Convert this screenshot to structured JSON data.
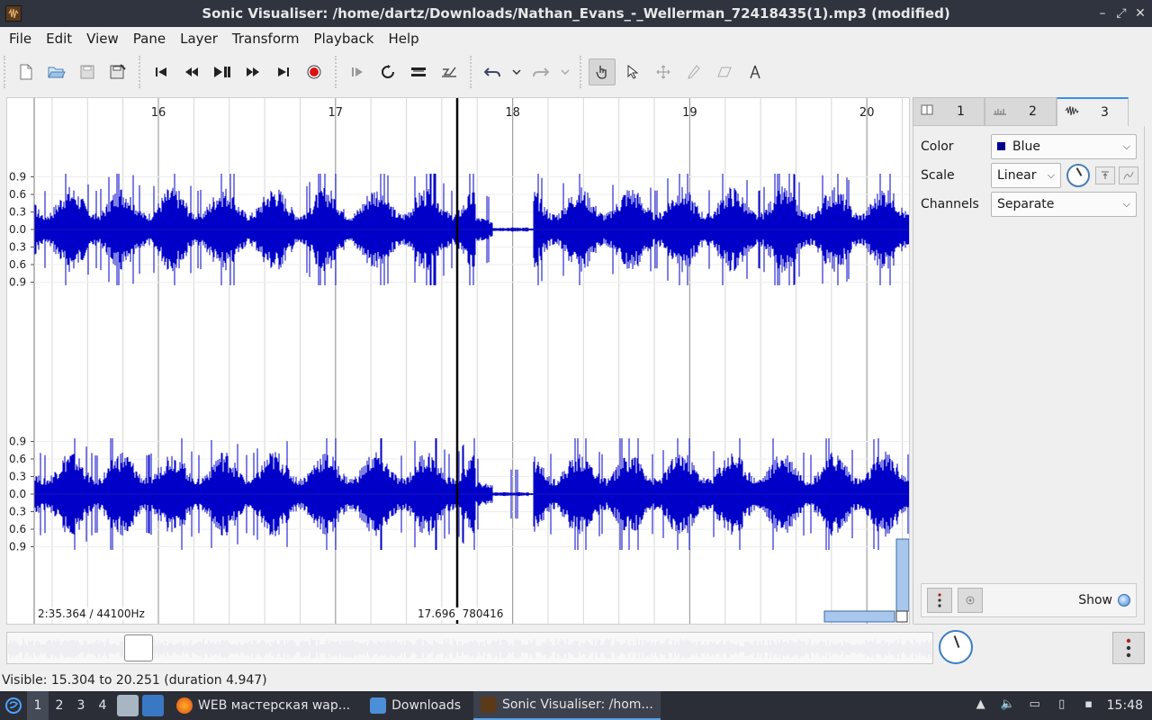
{
  "window": {
    "title": "Sonic Visualiser: /home/dartz/Downloads/Nathan_Evans_-_Wellerman_72418435(1).mp3 (modified)",
    "controls": [
      "–",
      "⤢",
      "✕"
    ]
  },
  "menu": [
    "File",
    "Edit",
    "View",
    "Pane",
    "Layer",
    "Transform",
    "Playback",
    "Help"
  ],
  "toolbar": {
    "file_icons": [
      "new-file-icon",
      "open-file-icon",
      "save-icon",
      "save-as-icon"
    ],
    "transport_icons": [
      "skip-to-start-icon",
      "rewind-icon",
      "play-pause-icon",
      "fast-forward-icon",
      "skip-to-end-icon",
      "record-icon"
    ],
    "playmode_icons": [
      "play-selection-icon",
      "loop-icon",
      "solo-icon",
      "speed-icon"
    ],
    "edit_icons": [
      "undo-icon",
      "undo-menu-icon",
      "redo-icon",
      "redo-menu-icon"
    ],
    "tool_icons": [
      "navigate-tool-icon",
      "select-tool-icon",
      "move-tool-icon",
      "draw-tool-icon",
      "erase-tool-icon",
      "measure-tool-icon"
    ]
  },
  "timeline": {
    "ticks": [
      "16",
      "17",
      "18",
      "19",
      "20"
    ],
    "amp_labels_top": [
      "0.9",
      "0.6",
      "0.3",
      "0.0",
      "0.3",
      "0.6",
      "0.9"
    ],
    "amp_labels_bottom": [
      "0.9",
      "0.6",
      "0.3",
      "0.0",
      "0.3",
      "0.6",
      "0.9"
    ],
    "bottom_left_info": "2:35.364 / 44100Hz",
    "playhead_info": "17.696  780416",
    "waveform_color": "#0000c8"
  },
  "panel": {
    "tabs": [
      {
        "label": "1",
        "icon": "pane-icon"
      },
      {
        "label": "2",
        "icon": "time-ruler-icon"
      },
      {
        "label": "3",
        "icon": "waveform-icon"
      }
    ],
    "color_label": "Color",
    "color_value": "Blue",
    "scale_label": "Scale",
    "scale_value": "Linear",
    "channels_label": "Channels",
    "channels_value": "Separate",
    "show_label": "Show"
  },
  "status": {
    "visible": "Visible: 15.304 to 20.251 (duration 4.947)"
  },
  "taskbar": {
    "workspaces": [
      "1",
      "2",
      "3",
      "4"
    ],
    "tasks": [
      {
        "label": "WEB мастерская wap...",
        "icon": "firefox-icon"
      },
      {
        "label": "Downloads",
        "icon": "folder-icon"
      },
      {
        "label": "Sonic Visualiser: /hom...",
        "icon": "sonic-visualiser-icon"
      }
    ],
    "clock": "15:48"
  }
}
